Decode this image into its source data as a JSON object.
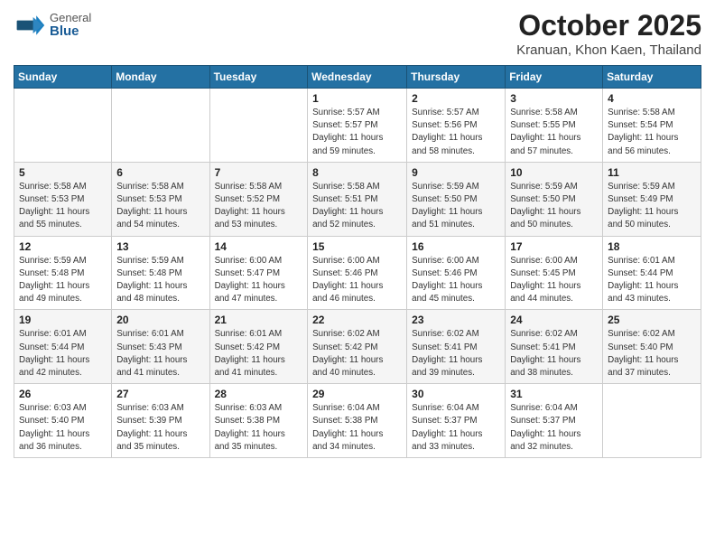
{
  "header": {
    "logo_general": "General",
    "logo_blue": "Blue",
    "month_title": "October 2025",
    "subtitle": "Kranuan, Khon Kaen, Thailand"
  },
  "days_of_week": [
    "Sunday",
    "Monday",
    "Tuesday",
    "Wednesday",
    "Thursday",
    "Friday",
    "Saturday"
  ],
  "weeks": [
    [
      {
        "day": "",
        "info": ""
      },
      {
        "day": "",
        "info": ""
      },
      {
        "day": "",
        "info": ""
      },
      {
        "day": "1",
        "info": "Sunrise: 5:57 AM\nSunset: 5:57 PM\nDaylight: 11 hours\nand 59 minutes."
      },
      {
        "day": "2",
        "info": "Sunrise: 5:57 AM\nSunset: 5:56 PM\nDaylight: 11 hours\nand 58 minutes."
      },
      {
        "day": "3",
        "info": "Sunrise: 5:58 AM\nSunset: 5:55 PM\nDaylight: 11 hours\nand 57 minutes."
      },
      {
        "day": "4",
        "info": "Sunrise: 5:58 AM\nSunset: 5:54 PM\nDaylight: 11 hours\nand 56 minutes."
      }
    ],
    [
      {
        "day": "5",
        "info": "Sunrise: 5:58 AM\nSunset: 5:53 PM\nDaylight: 11 hours\nand 55 minutes."
      },
      {
        "day": "6",
        "info": "Sunrise: 5:58 AM\nSunset: 5:53 PM\nDaylight: 11 hours\nand 54 minutes."
      },
      {
        "day": "7",
        "info": "Sunrise: 5:58 AM\nSunset: 5:52 PM\nDaylight: 11 hours\nand 53 minutes."
      },
      {
        "day": "8",
        "info": "Sunrise: 5:58 AM\nSunset: 5:51 PM\nDaylight: 11 hours\nand 52 minutes."
      },
      {
        "day": "9",
        "info": "Sunrise: 5:59 AM\nSunset: 5:50 PM\nDaylight: 11 hours\nand 51 minutes."
      },
      {
        "day": "10",
        "info": "Sunrise: 5:59 AM\nSunset: 5:50 PM\nDaylight: 11 hours\nand 50 minutes."
      },
      {
        "day": "11",
        "info": "Sunrise: 5:59 AM\nSunset: 5:49 PM\nDaylight: 11 hours\nand 50 minutes."
      }
    ],
    [
      {
        "day": "12",
        "info": "Sunrise: 5:59 AM\nSunset: 5:48 PM\nDaylight: 11 hours\nand 49 minutes."
      },
      {
        "day": "13",
        "info": "Sunrise: 5:59 AM\nSunset: 5:48 PM\nDaylight: 11 hours\nand 48 minutes."
      },
      {
        "day": "14",
        "info": "Sunrise: 6:00 AM\nSunset: 5:47 PM\nDaylight: 11 hours\nand 47 minutes."
      },
      {
        "day": "15",
        "info": "Sunrise: 6:00 AM\nSunset: 5:46 PM\nDaylight: 11 hours\nand 46 minutes."
      },
      {
        "day": "16",
        "info": "Sunrise: 6:00 AM\nSunset: 5:46 PM\nDaylight: 11 hours\nand 45 minutes."
      },
      {
        "day": "17",
        "info": "Sunrise: 6:00 AM\nSunset: 5:45 PM\nDaylight: 11 hours\nand 44 minutes."
      },
      {
        "day": "18",
        "info": "Sunrise: 6:01 AM\nSunset: 5:44 PM\nDaylight: 11 hours\nand 43 minutes."
      }
    ],
    [
      {
        "day": "19",
        "info": "Sunrise: 6:01 AM\nSunset: 5:44 PM\nDaylight: 11 hours\nand 42 minutes."
      },
      {
        "day": "20",
        "info": "Sunrise: 6:01 AM\nSunset: 5:43 PM\nDaylight: 11 hours\nand 41 minutes."
      },
      {
        "day": "21",
        "info": "Sunrise: 6:01 AM\nSunset: 5:42 PM\nDaylight: 11 hours\nand 41 minutes."
      },
      {
        "day": "22",
        "info": "Sunrise: 6:02 AM\nSunset: 5:42 PM\nDaylight: 11 hours\nand 40 minutes."
      },
      {
        "day": "23",
        "info": "Sunrise: 6:02 AM\nSunset: 5:41 PM\nDaylight: 11 hours\nand 39 minutes."
      },
      {
        "day": "24",
        "info": "Sunrise: 6:02 AM\nSunset: 5:41 PM\nDaylight: 11 hours\nand 38 minutes."
      },
      {
        "day": "25",
        "info": "Sunrise: 6:02 AM\nSunset: 5:40 PM\nDaylight: 11 hours\nand 37 minutes."
      }
    ],
    [
      {
        "day": "26",
        "info": "Sunrise: 6:03 AM\nSunset: 5:40 PM\nDaylight: 11 hours\nand 36 minutes."
      },
      {
        "day": "27",
        "info": "Sunrise: 6:03 AM\nSunset: 5:39 PM\nDaylight: 11 hours\nand 35 minutes."
      },
      {
        "day": "28",
        "info": "Sunrise: 6:03 AM\nSunset: 5:38 PM\nDaylight: 11 hours\nand 35 minutes."
      },
      {
        "day": "29",
        "info": "Sunrise: 6:04 AM\nSunset: 5:38 PM\nDaylight: 11 hours\nand 34 minutes."
      },
      {
        "day": "30",
        "info": "Sunrise: 6:04 AM\nSunset: 5:37 PM\nDaylight: 11 hours\nand 33 minutes."
      },
      {
        "day": "31",
        "info": "Sunrise: 6:04 AM\nSunset: 5:37 PM\nDaylight: 11 hours\nand 32 minutes."
      },
      {
        "day": "",
        "info": ""
      }
    ]
  ]
}
